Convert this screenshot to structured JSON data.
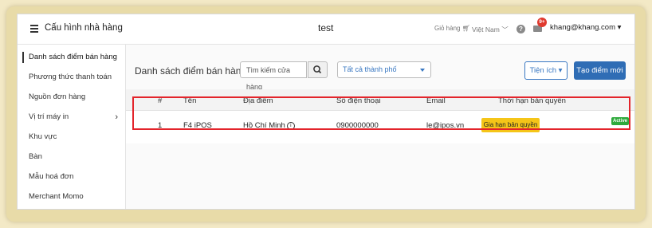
{
  "header": {
    "app_title": "Cấu hình nhà hàng",
    "center_title": "test",
    "cart_label": "Giỏ hàng",
    "language": "Việt Nam",
    "notification_count": "9+",
    "user_email": "khang@khang.com"
  },
  "sidebar": {
    "items": [
      {
        "label": "Danh sách điểm bán hàng"
      },
      {
        "label": "Phương thức thanh toán"
      },
      {
        "label": "Nguồn đơn hàng"
      },
      {
        "label": "Vị trí máy in"
      },
      {
        "label": "Khu vực"
      },
      {
        "label": "Bàn"
      },
      {
        "label": "Mẫu hoá đơn"
      },
      {
        "label": "Merchant Momo"
      }
    ]
  },
  "main": {
    "title": "Danh sách điểm bán hàng",
    "search_placeholder": "Tìm kiếm cửa hàng",
    "city_select": "Tất cả thành phố",
    "utilities_label": "Tiện ích",
    "new_label": "Tạo điểm mới"
  },
  "table": {
    "columns": [
      "#",
      "Tên",
      "Địa điểm",
      "Số điện thoại",
      "Email",
      "Thời hạn bản quyền"
    ],
    "rows": [
      {
        "index": "1",
        "name": "F4 iPOS",
        "location": "Hồ Chí Minh",
        "phone": "0900000000",
        "email": "le@ipos.vn",
        "license_action": "Gia hạn bản quyền",
        "status": "Active"
      }
    ]
  },
  "colors": {
    "accent": "#2f6db5",
    "highlight": "#e3242b",
    "renew_button": "#f5c518",
    "status_active": "#2eaa3c"
  }
}
